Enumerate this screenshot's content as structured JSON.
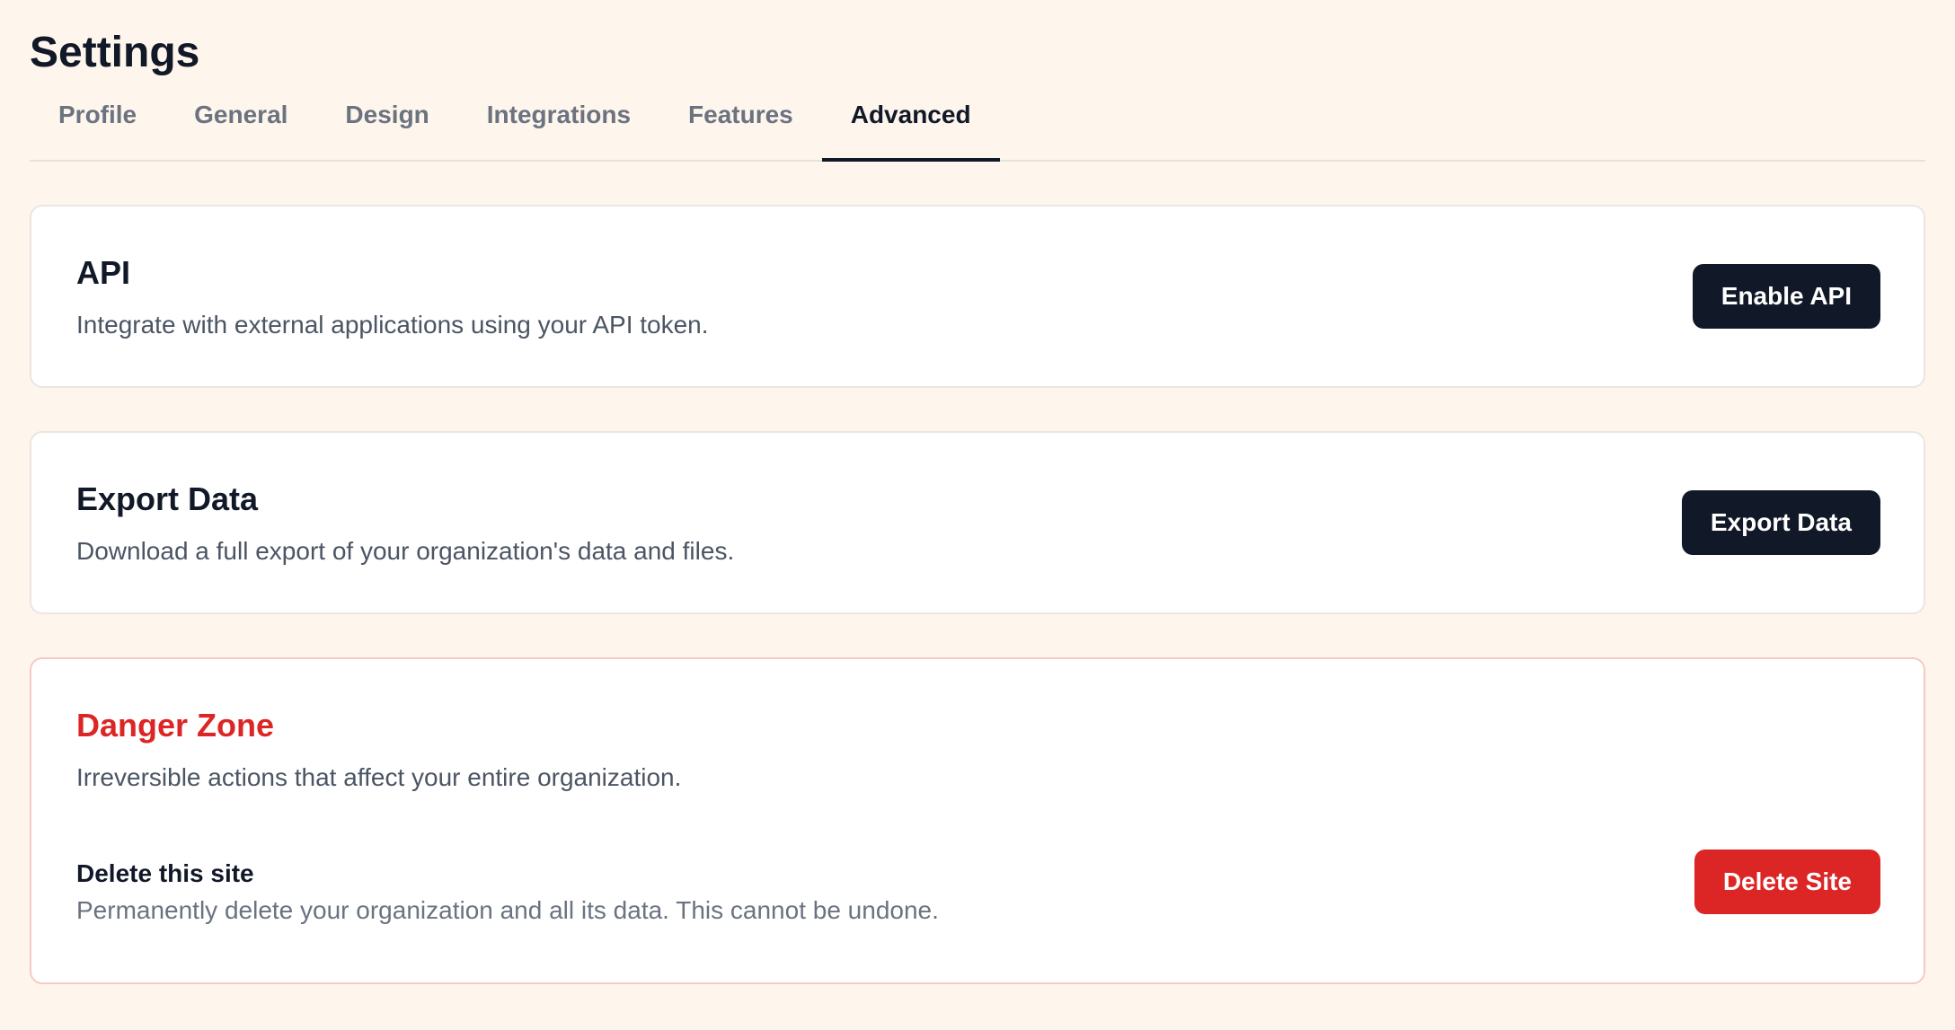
{
  "page": {
    "title": "Settings"
  },
  "tabs": [
    {
      "label": "Profile",
      "active": false
    },
    {
      "label": "General",
      "active": false
    },
    {
      "label": "Design",
      "active": false
    },
    {
      "label": "Integrations",
      "active": false
    },
    {
      "label": "Features",
      "active": false
    },
    {
      "label": "Advanced",
      "active": true
    }
  ],
  "api": {
    "title": "API",
    "description": "Integrate with external applications using your API token.",
    "button_label": "Enable API"
  },
  "export": {
    "title": "Export Data",
    "description": "Download a full export of your organization's data and files.",
    "button_label": "Export Data"
  },
  "danger": {
    "title": "Danger Zone",
    "description": "Irreversible actions that affect your entire organization.",
    "delete": {
      "title": "Delete this site",
      "description": "Permanently delete your organization and all its data. This cannot be undone.",
      "button_label": "Delete Site"
    }
  },
  "colors": {
    "background": "#fef5ec",
    "primary_button": "#111827",
    "danger": "#dc2626",
    "danger_border": "#f6c9c4"
  }
}
